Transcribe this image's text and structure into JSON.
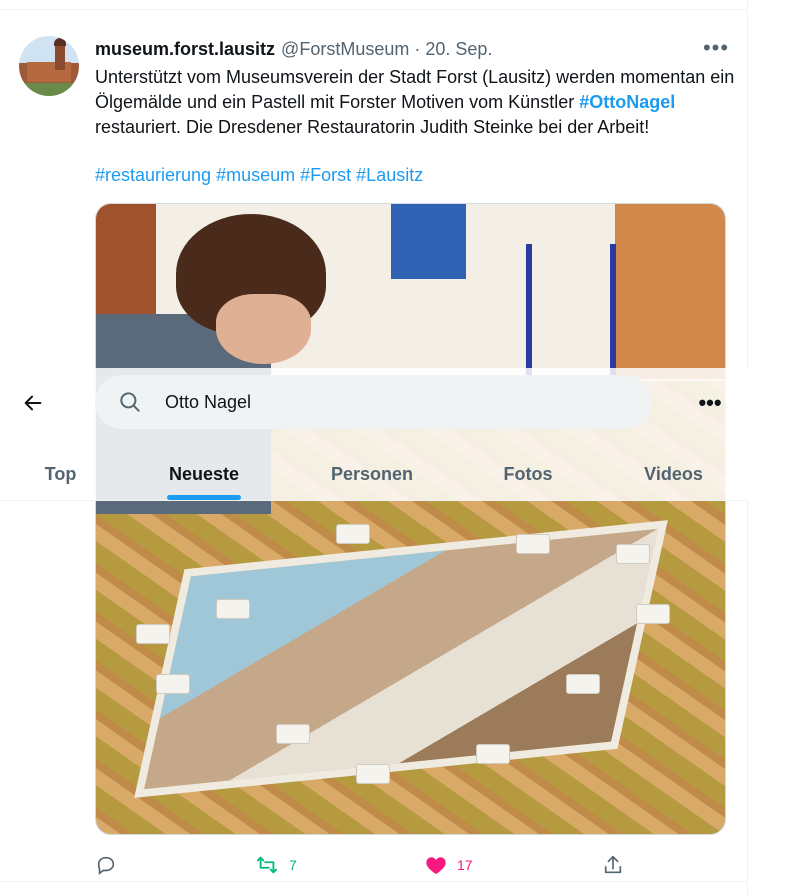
{
  "tweet": {
    "display_name": "museum.forst.lausitz",
    "handle": "@ForstMuseum",
    "separator": "·",
    "date": "20. Sep.",
    "more_icon": "more-horizontal-icon",
    "text_part1": "Unterstützt vom Museumsverein der Stadt Forst (Lausitz) werden momentan ein Ölgemälde und ein Pastell mit Forster Motiven vom Künstler ",
    "mention": "#OttoNagel",
    "text_part2": " restauriert. Die Dresdener Restauratorin Judith Steinke bei der Arbeit!",
    "hashtags": [
      "#restaurierung",
      "#museum",
      "#Forst",
      " #Lausitz"
    ],
    "actions": {
      "reply_icon": "reply-icon",
      "retweet_icon": "retweet-icon",
      "retweet_count": "7",
      "like_icon": "heart-icon",
      "like_count": "17",
      "share_icon": "share-icon"
    }
  },
  "search_header": {
    "back_icon": "arrow-left-icon",
    "search_icon": "search-icon",
    "query": "Otto Nagel",
    "more_icon": "more-horizontal-icon",
    "tabs": [
      {
        "label": "Top",
        "active": false
      },
      {
        "label": "Neueste",
        "active": true
      },
      {
        "label": "Personen",
        "active": false
      },
      {
        "label": "Fotos",
        "active": false
      },
      {
        "label": "Videos",
        "active": false
      }
    ]
  },
  "colors": {
    "accent": "#1d9bf0",
    "retweet": "#00ba7c",
    "like": "#f91880",
    "secondary_text": "#536471"
  }
}
